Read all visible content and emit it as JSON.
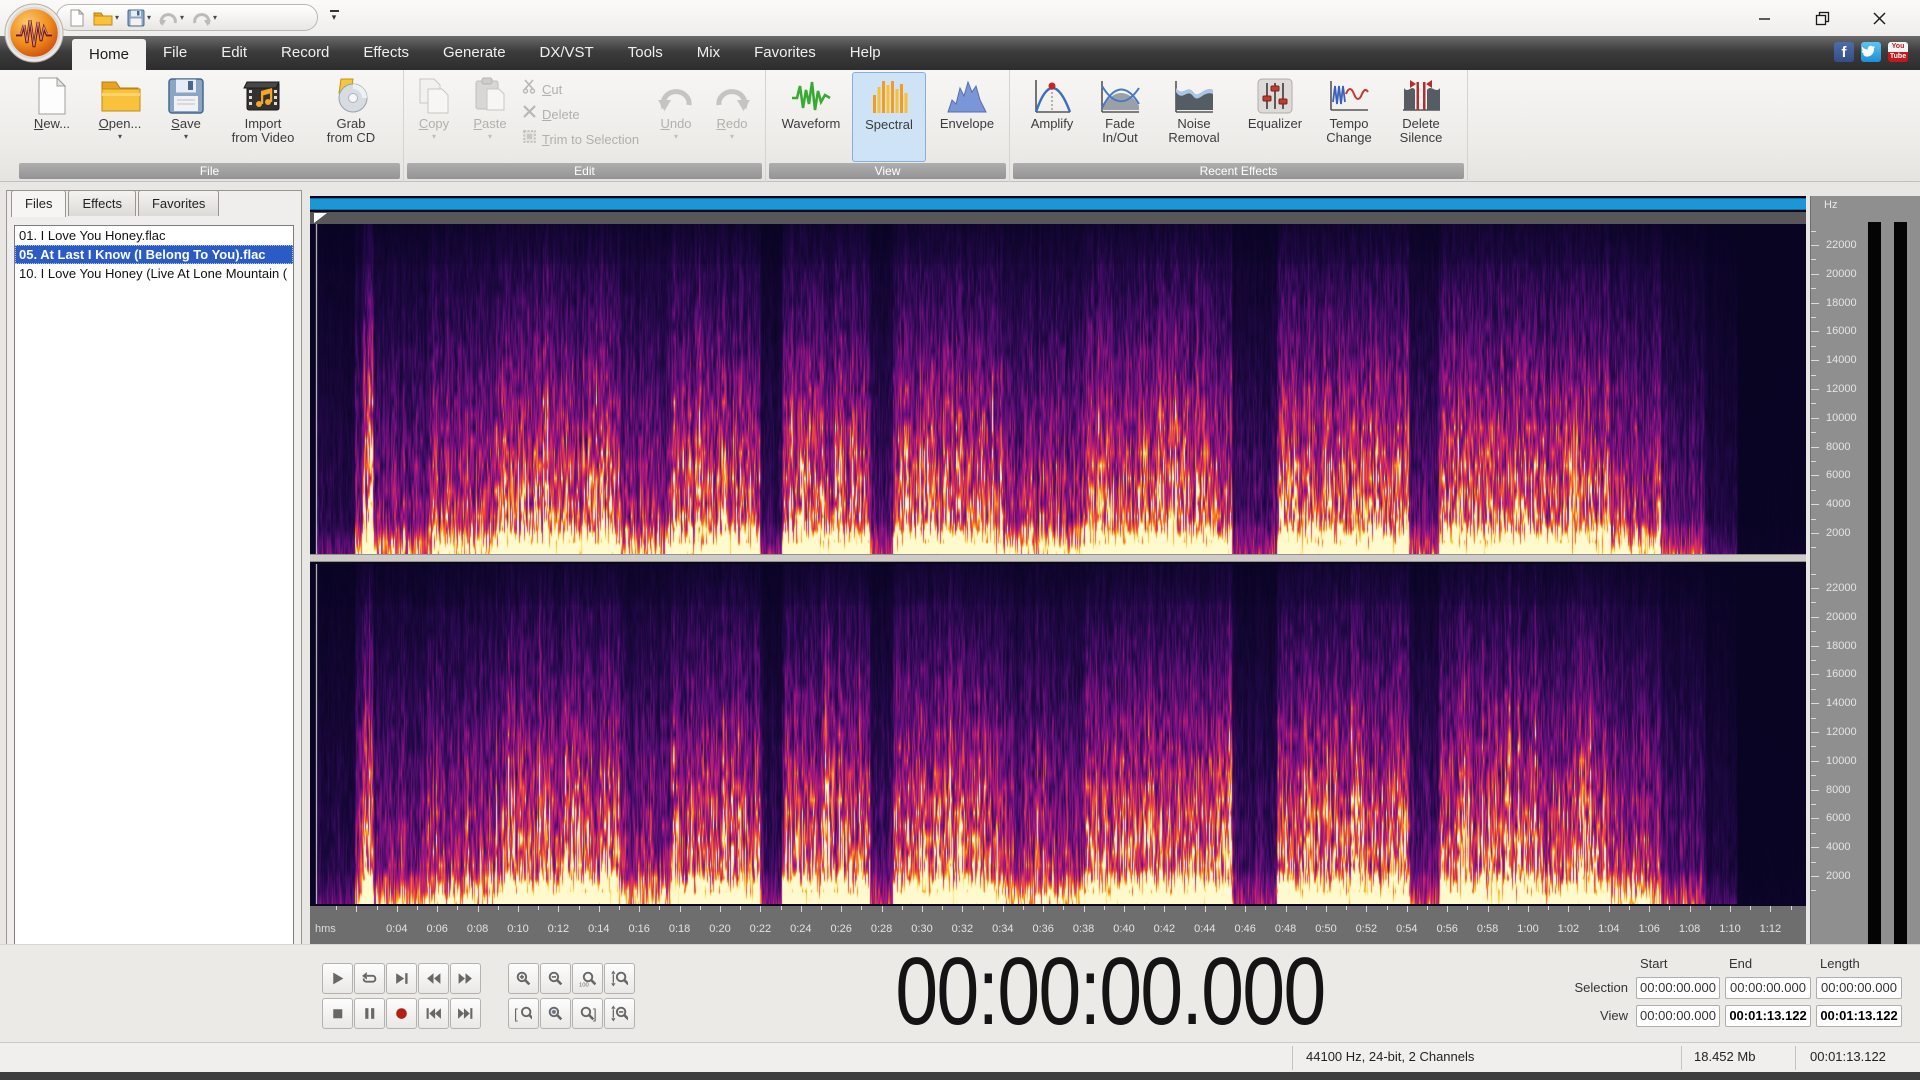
{
  "app": {
    "logo": "audio-editor-logo"
  },
  "quick_access": {
    "icons": [
      "new-document-icon",
      "open-folder-icon",
      "save-icon",
      "undo-icon",
      "redo-icon"
    ],
    "customize_icon": "customize-quick-access-icon"
  },
  "window_controls": {
    "icons": [
      "minimize-icon",
      "maximize-icon",
      "close-icon"
    ]
  },
  "menu": {
    "tabs": [
      "Home",
      "File",
      "Edit",
      "Record",
      "Effects",
      "Generate",
      "DX/VST",
      "Tools",
      "Mix",
      "Favorites",
      "Help"
    ],
    "active_tab": "Home"
  },
  "social": {
    "icons": [
      "facebook-icon",
      "twitter-icon",
      "youtube-icon"
    ],
    "facebook_letter": "f",
    "youtube_top": "You",
    "youtube_bottom": "Tube"
  },
  "ribbon": {
    "file": {
      "label": "File",
      "new": "New...",
      "open": "Open...",
      "save": "Save",
      "import_line1": "Import",
      "import_line2": "from Video",
      "grab_line1": "Grab",
      "grab_line2": "from CD"
    },
    "edit": {
      "label": "Edit",
      "copy": "Copy",
      "paste": "Paste",
      "cut": "Cut",
      "del": "Delete",
      "trim": "Trim to Selection",
      "undo": "Undo",
      "redo": "Redo"
    },
    "view": {
      "label": "View",
      "waveform": "Waveform",
      "spectral": "Spectral",
      "envelope": "Envelope",
      "selected": "Spectral"
    },
    "recent_effects": {
      "label": "Recent Effects",
      "amplify": "Amplify",
      "fade_line1": "Fade",
      "fade_line2": "In/Out",
      "noise_line1": "Noise",
      "noise_line2": "Removal",
      "equalizer": "Equalizer",
      "tempo_line1": "Tempo",
      "tempo_line2": "Change",
      "silence_line1": "Delete",
      "silence_line2": "Silence"
    }
  },
  "left_panel": {
    "tabs": [
      "Files",
      "Effects",
      "Favorites"
    ],
    "active_tab": "Files",
    "files": [
      {
        "name": "01. I Love You Honey.flac",
        "selected": false
      },
      {
        "name": "05. At Last I Know (I Belong To You).flac",
        "selected": true
      },
      {
        "name": "10. I Love You Honey (Live At Lone Mountain (",
        "selected": false
      }
    ]
  },
  "editor": {
    "channels": 2,
    "freq_axis": {
      "unit": "Hz",
      "labels": [
        "22000",
        "20000",
        "18000",
        "16000",
        "14000",
        "12000",
        "10000",
        "8000",
        "6000",
        "4000",
        "2000"
      ]
    },
    "timeline": {
      "unit": "hms",
      "labels": [
        "0:04",
        "0:06",
        "0:08",
        "0:10",
        "0:12",
        "0:14",
        "0:16",
        "0:18",
        "0:20",
        "0:22",
        "0:24",
        "0:26",
        "0:28",
        "0:30",
        "0:32",
        "0:34",
        "0:36",
        "0:38",
        "0:40",
        "0:42",
        "0:44",
        "0:46",
        "0:48",
        "0:50",
        "0:52",
        "0:54",
        "0:56",
        "0:58",
        "1:00",
        "1:02",
        "1:04",
        "1:06",
        "1:08",
        "1:10",
        "1:12"
      ]
    }
  },
  "transport": {
    "rows": [
      [
        "play",
        "loop",
        "play-to-cursor",
        "rewind",
        "fast-forward"
      ],
      [
        "stop",
        "pause",
        "record",
        "go-to-start",
        "go-to-end"
      ]
    ]
  },
  "zoom_controls": {
    "rows": [
      [
        "zoom-in",
        "zoom-out",
        "zoom-100",
        "zoom-vertical-in"
      ],
      [
        "zoom-selection",
        "zoom-in-center",
        "zoom-out-selection",
        "zoom-vertical-out"
      ]
    ]
  },
  "time_display": "00:00:00.000",
  "position_panel": {
    "columns": [
      "Start",
      "End",
      "Length"
    ],
    "rows": [
      {
        "label": "Selection",
        "values": [
          "00:00:00.000",
          "00:00:00.000",
          "00:00:00.000"
        ]
      },
      {
        "label": "View",
        "values": [
          "00:00:00.000",
          "00:01:13.122",
          "00:01:13.122"
        ]
      }
    ]
  },
  "status_bar": {
    "format": "44100 Hz, 24-bit, 2 Channels",
    "file_size": "18.452 Mb",
    "duration": "00:01:13.122"
  },
  "colors": {
    "navigator_blue": "#1b97d5",
    "selection_blue": "#2b5cc5",
    "record_red": "#b41f14",
    "waveform_green": "#3aaa35",
    "spectral_selected_bg": "#cfe3f7",
    "tabstrip_dark": "#3c3c3c"
  }
}
